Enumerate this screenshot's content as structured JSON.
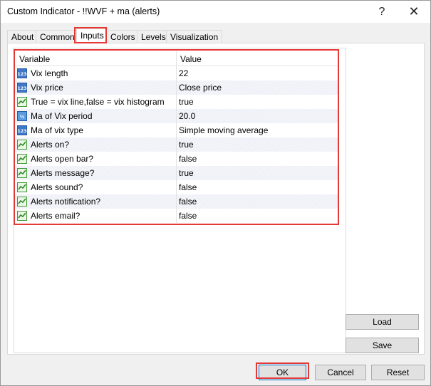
{
  "window": {
    "title": "Custom Indicator - !!WVF + ma (alerts)",
    "help_glyph": "?",
    "close_glyph": "✕"
  },
  "tabs": [
    {
      "label": "About"
    },
    {
      "label": "Common"
    },
    {
      "label": "Inputs",
      "active": true
    },
    {
      "label": "Colors"
    },
    {
      "label": "Levels"
    },
    {
      "label": "Visualization"
    }
  ],
  "grid": {
    "headers": {
      "variable": "Variable",
      "value": "Value"
    },
    "rows": [
      {
        "name": "Vix length",
        "value": "22",
        "icon": "integer-icon"
      },
      {
        "name": "Vix price",
        "value": "Close price",
        "icon": "integer-icon"
      },
      {
        "name": "True = vix line,false = vix histogram",
        "value": "true",
        "icon": "boolean-icon"
      },
      {
        "name": "Ma of Vix period",
        "value": "20.0",
        "icon": "double-icon"
      },
      {
        "name": "Ma of vix type",
        "value": "Simple moving average",
        "icon": "integer-icon"
      },
      {
        "name": "Alerts on?",
        "value": "true",
        "icon": "boolean-icon"
      },
      {
        "name": "Alerts open bar?",
        "value": "false",
        "icon": "boolean-icon"
      },
      {
        "name": "Alerts message?",
        "value": "true",
        "icon": "boolean-icon"
      },
      {
        "name": "Alerts sound?",
        "value": "false",
        "icon": "boolean-icon"
      },
      {
        "name": "Alerts notification?",
        "value": "false",
        "icon": "boolean-icon"
      },
      {
        "name": "Alerts email?",
        "value": "false",
        "icon": "boolean-icon"
      }
    ]
  },
  "side_buttons": {
    "load": "Load",
    "save": "Save"
  },
  "footer": {
    "ok": "OK",
    "cancel": "Cancel",
    "reset": "Reset"
  },
  "colors": {
    "highlight": "#e53935",
    "ok_border": "#0078d7"
  }
}
